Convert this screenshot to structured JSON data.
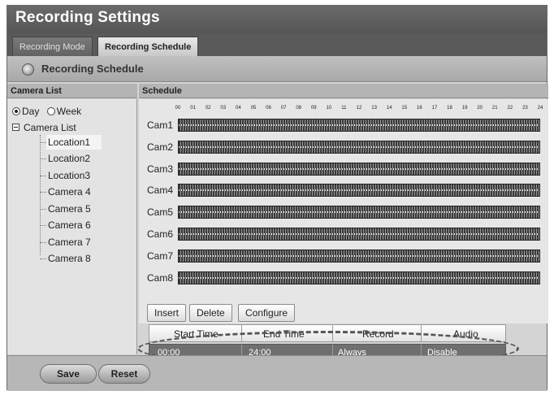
{
  "window": {
    "title": "Recording Settings"
  },
  "tabs": [
    {
      "label": "Recording Mode",
      "active": false
    },
    {
      "label": "Recording Schedule",
      "active": true
    }
  ],
  "section": {
    "title": "Recording Schedule",
    "icon": "settings-ring-icon"
  },
  "left_panel": {
    "header": "Camera List",
    "view_mode": {
      "options": [
        "Day",
        "Week"
      ],
      "selected": "Day"
    },
    "tree_root": "Camera List",
    "items": [
      {
        "label": "Location1",
        "selected": true
      },
      {
        "label": "Location2",
        "selected": false
      },
      {
        "label": "Location3",
        "selected": false
      },
      {
        "label": "Camera 4",
        "selected": false
      },
      {
        "label": "Camera 5",
        "selected": false
      },
      {
        "label": "Camera 6",
        "selected": false
      },
      {
        "label": "Camera 7",
        "selected": false
      },
      {
        "label": "Camera 8",
        "selected": false
      }
    ]
  },
  "schedule": {
    "header": "Schedule",
    "hours": [
      "00",
      "01",
      "02",
      "03",
      "04",
      "05",
      "06",
      "07",
      "08",
      "09",
      "10",
      "11",
      "12",
      "13",
      "14",
      "15",
      "16",
      "17",
      "18",
      "19",
      "20",
      "21",
      "22",
      "23",
      "24"
    ],
    "cameras": [
      "Cam1",
      "Cam2",
      "Cam3",
      "Cam4",
      "Cam5",
      "Cam6",
      "Cam7",
      "Cam8"
    ]
  },
  "actions": {
    "insert": "Insert",
    "delete": "Delete",
    "configure": "Configure"
  },
  "rules_table": {
    "columns": [
      "Start Time",
      "End Time",
      "Record",
      "Audio"
    ],
    "rows": [
      {
        "start": "00:00",
        "end": "24:00",
        "record": "Always",
        "audio": "Disable"
      }
    ]
  },
  "footer": {
    "save": "Save",
    "reset": "Reset"
  },
  "colors": {
    "selected_row": "#6f6f6f",
    "schedule_bar": "#3b3b3b"
  }
}
